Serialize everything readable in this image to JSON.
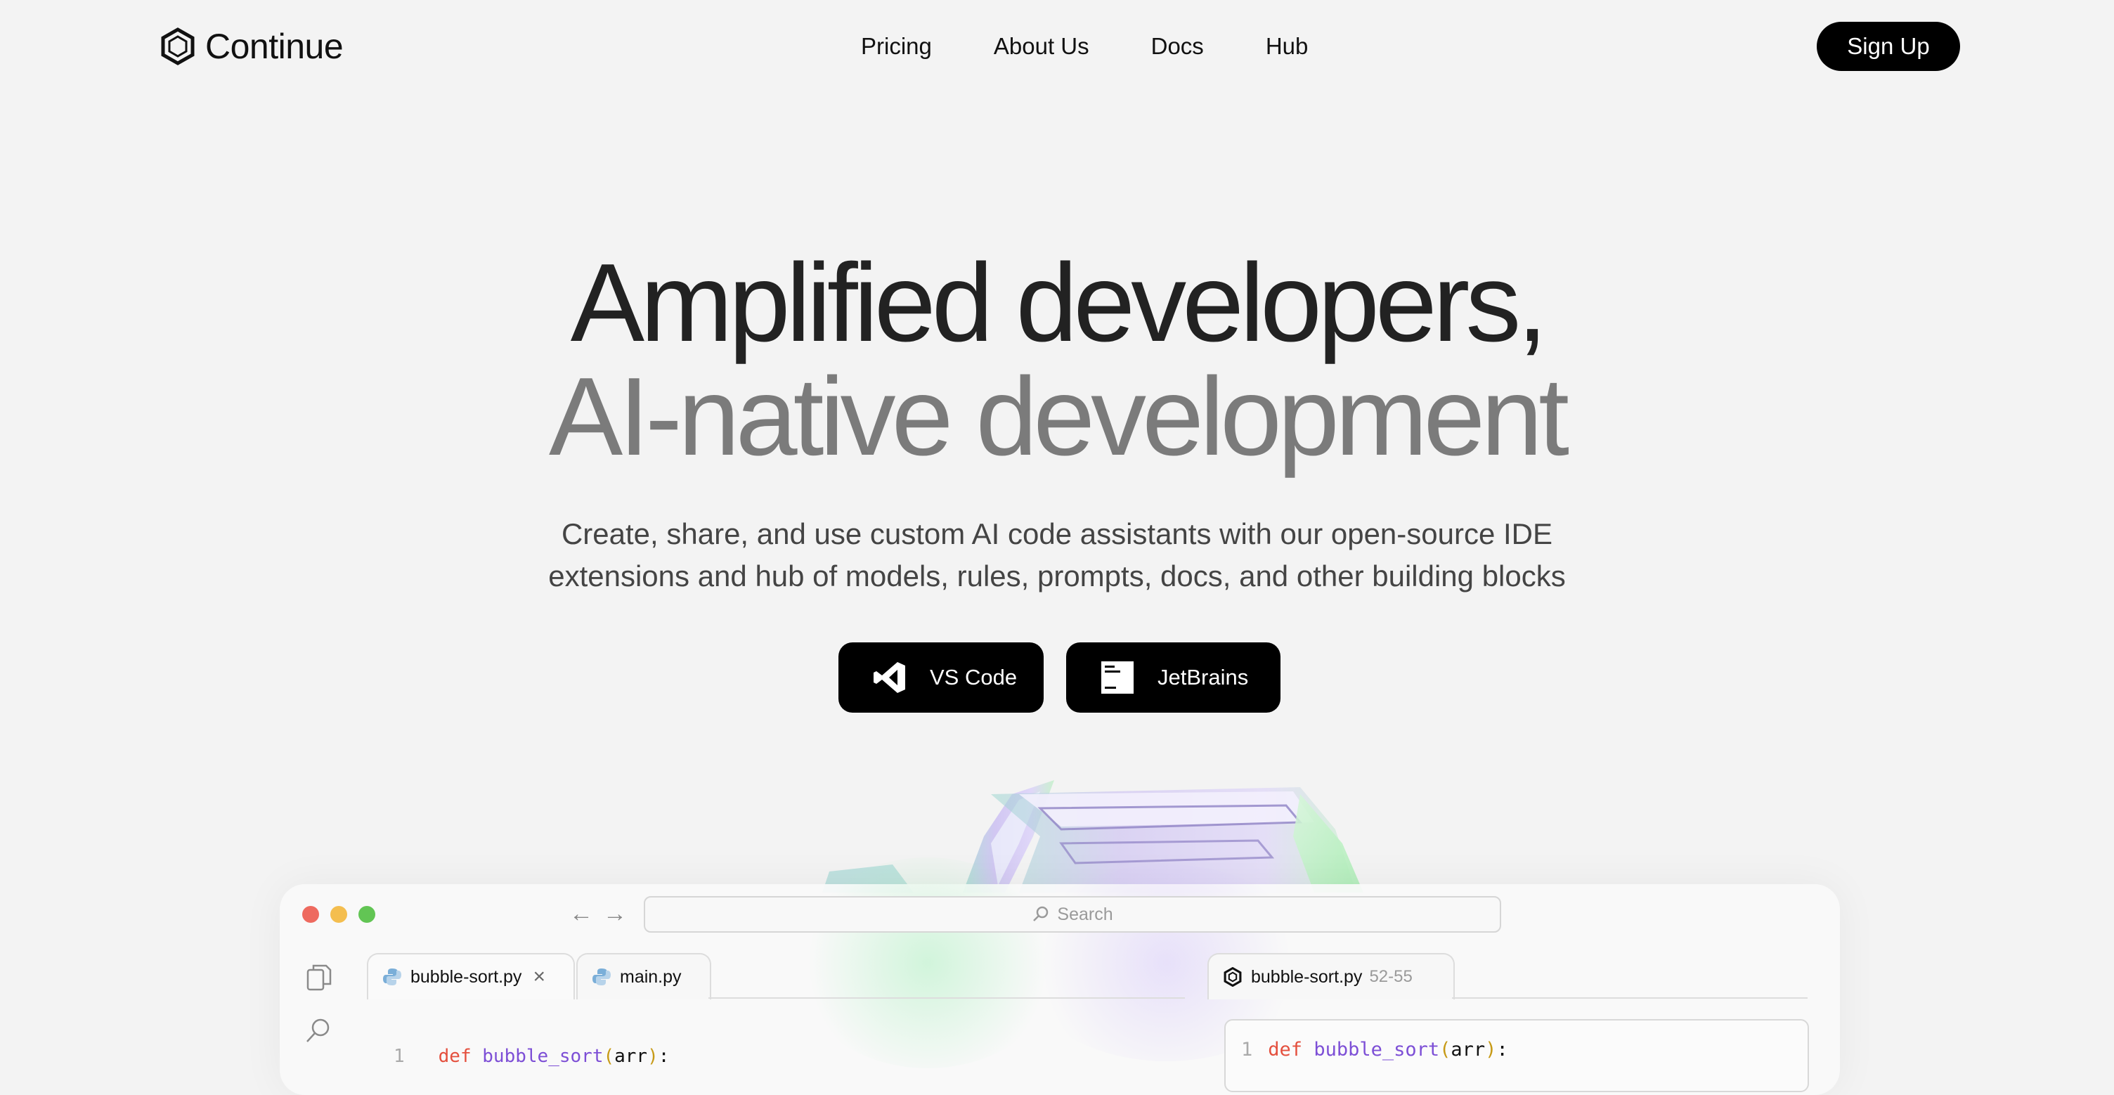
{
  "brand": {
    "name": "Continue",
    "logo_icon": "continue-logo-icon"
  },
  "nav": {
    "links": [
      "Pricing",
      "About Us",
      "Docs",
      "Hub"
    ],
    "signup_label": "Sign Up"
  },
  "hero": {
    "title_line1": "Amplified developers,",
    "title_line2": "AI-native development",
    "subtitle_line1": "Create, share, and use custom AI code assistants with our open-source IDE",
    "subtitle_line2": "extensions and hub of models, rules, prompts, docs, and other building blocks",
    "cta": [
      {
        "label": "VS Code",
        "icon": "vscode-icon"
      },
      {
        "label": "JetBrains",
        "icon": "jetbrains-icon"
      }
    ]
  },
  "ide": {
    "window_controls": [
      "close",
      "minimize",
      "maximize"
    ],
    "search_placeholder": "Search",
    "tabs": [
      {
        "label": "bubble-sort.py",
        "icon": "python-icon",
        "active": true,
        "closable": true
      },
      {
        "label": "main.py",
        "icon": "python-icon",
        "active": false
      }
    ],
    "right_tab": {
      "label": "bubble-sort.py",
      "range": "52-55",
      "icon": "continue-logo-icon"
    },
    "code_left": {
      "line": "1",
      "keyword": "def",
      "fn": "bubble_sort",
      "open": "(",
      "arg": "arr",
      "close": ")",
      "colon": ":"
    },
    "code_right": {
      "line": "1",
      "keyword": "def",
      "fn": "bubble_sort",
      "open": "(",
      "arg": "arr",
      "close": ")",
      "colon": ":"
    }
  },
  "colors": {
    "background": "#f3f3f3",
    "button": "#000000",
    "title_primary": "#222222",
    "title_secondary": "#7b7b7b",
    "keyword": "#e4503e",
    "function": "#7d4fd6",
    "paren": "#c79a16"
  }
}
